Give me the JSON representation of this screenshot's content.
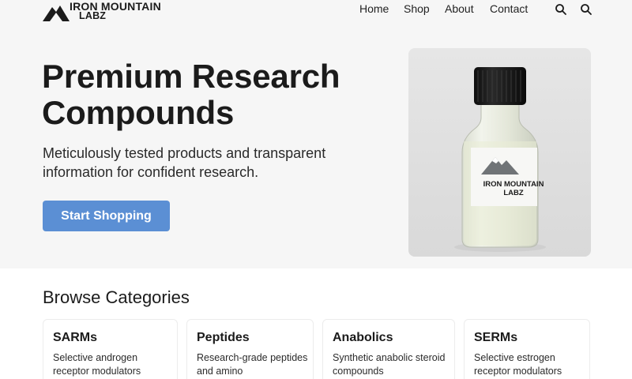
{
  "header": {
    "logo_line1": "IRON MOUNTAIN",
    "logo_line2": "LABZ",
    "logo_icon": "mountain-icon",
    "nav": [
      "Home",
      "Shop",
      "About",
      "Contact"
    ],
    "icons": [
      "search-icon",
      "search-icon"
    ]
  },
  "hero": {
    "title": "Premium Research Compounds",
    "subtitle": "Meticulously tested products and transparent information for confident research.",
    "cta_label": "Start Shopping",
    "product_label_line1": "IRON MOUNTAIN",
    "product_label_line2": "LABZ"
  },
  "browse": {
    "title": "Browse Categories",
    "categories": [
      {
        "title": "SARMs",
        "desc": "Selective androgen receptor modulators"
      },
      {
        "title": "Peptides",
        "desc": "Research-grade peptides and amino"
      },
      {
        "title": "Anabolics",
        "desc": "Synthetic anabolic steroid compounds"
      },
      {
        "title": "SERMs",
        "desc": "Selective estrogen receptor modulators"
      }
    ]
  },
  "colors": {
    "accent": "#5b8fd4",
    "hero_bg": "#f6f6f6",
    "text": "#1b1b1b"
  }
}
